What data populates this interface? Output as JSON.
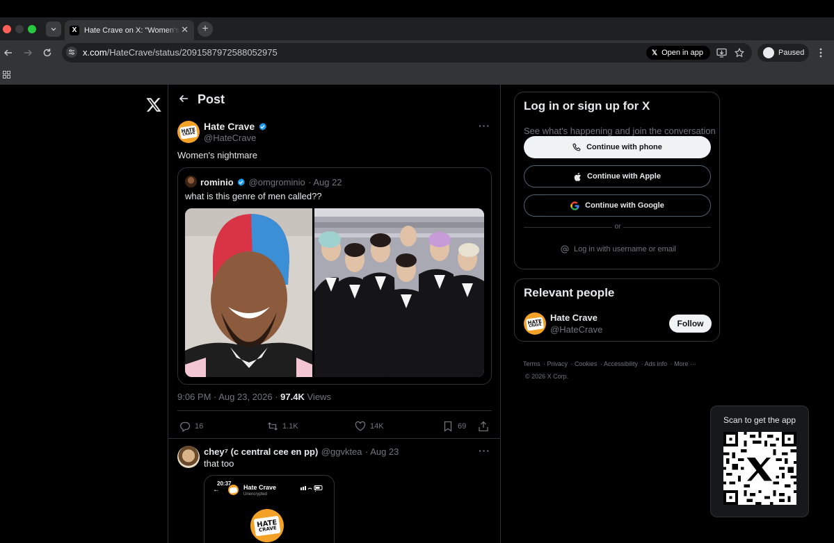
{
  "browser": {
    "tab_title": "Hate Crave on X: \"Women's n",
    "tab_favicon": "X",
    "url_host": "x.com",
    "url_path": "/HateCrave/status/2091587972588052975",
    "open_in_app": "Open in app",
    "profile_status": "Paused"
  },
  "post_header": "Post",
  "tweet": {
    "author_name": "Hate Crave",
    "author_handle": "@HateCrave",
    "text": "Women's nightmare",
    "avatar_line1": "HATE",
    "avatar_line2": "CRAVE",
    "quote": {
      "name": "rominio",
      "handle": "@omgrominio",
      "date": "· Aug 22",
      "text": "what is this genre of men called??"
    },
    "time": "9:06 PM · Aug 23, 2026 ·",
    "views_count": "97.4K",
    "views_label": "Views",
    "actions": {
      "replies": "16",
      "reposts": "1.1K",
      "likes": "14K",
      "bookmarks": "69"
    }
  },
  "reply": {
    "name": "chey⁷ (c central cee en pp)",
    "handle": "@ggvktea",
    "date": "· Aug 23",
    "text": "that too",
    "embedded_time": "20:37",
    "embedded_name": "Hate Crave",
    "embedded_status": "Unencrypted"
  },
  "login_card": {
    "title": "Log in or sign up for X",
    "subtitle": "See what's happening and join the conversation",
    "phone": "Continue with phone",
    "apple": "Continue with Apple",
    "google": "Continue with Google",
    "or": "or",
    "username": "Log in with username or email"
  },
  "people_card": {
    "title": "Relevant people",
    "name": "Hate Crave",
    "handle": "@HateCrave",
    "follow": "Follow"
  },
  "footer": {
    "links": [
      "Terms",
      "Privacy",
      "Cookies",
      "Accessibility",
      "Ads info",
      "More ···"
    ],
    "copyright": "© 2026 X Corp."
  },
  "qr": {
    "label": "Scan to get the app"
  },
  "colors": {
    "accent": "#1d9bf0",
    "background": "#000000",
    "border": "#2f3336",
    "muted": "#71767b"
  }
}
